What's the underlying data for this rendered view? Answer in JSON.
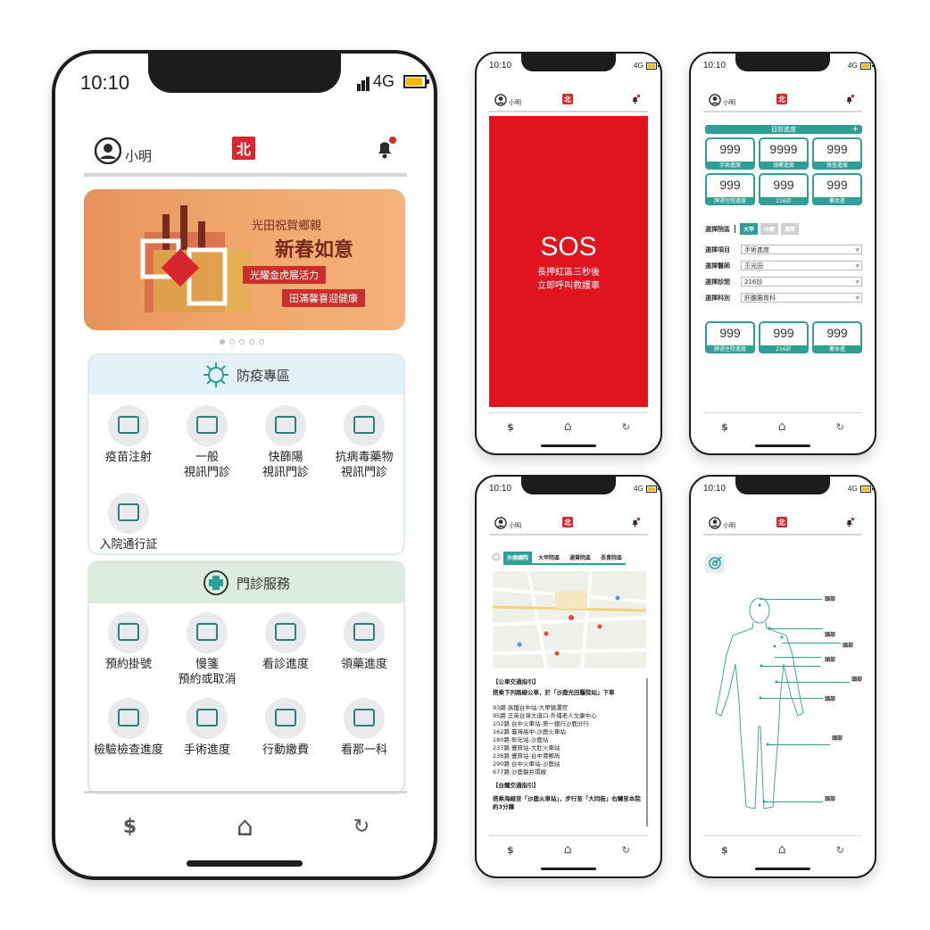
{
  "status": {
    "time": "10:10",
    "network": "4G"
  },
  "header": {
    "user": "小明",
    "logo_text": "北"
  },
  "banner": {
    "line1": "光田祝賀鄉親",
    "line2": "新春如意",
    "line3": "光耀金虎展活力",
    "line4": "田滿馨喜迎健康"
  },
  "sections": [
    {
      "title": "防疫專區",
      "items": [
        {
          "label": "疫苗注射"
        },
        {
          "label": "一般\n視訊門診"
        },
        {
          "label": "快篩陽\n視訊門診"
        },
        {
          "label": "抗病毒藥物\n視訊門診"
        },
        {
          "label": "入院通行証"
        }
      ]
    },
    {
      "title": "門診服務",
      "items": [
        {
          "label": "預約掛號"
        },
        {
          "label": "慢箋\n預約或取消"
        },
        {
          "label": "看診進度"
        },
        {
          "label": "領藥進度"
        },
        {
          "label": "檢驗檢查進度"
        },
        {
          "label": "手術進度"
        },
        {
          "label": "行動繳費"
        },
        {
          "label": "看那一科"
        }
      ]
    }
  ],
  "nav": {
    "pay": "$",
    "home": "⌂",
    "refresh": "↻"
  },
  "sos": {
    "title": "SOS",
    "line1": "長押紅區三秒後",
    "line2": "立即呼叫救護車"
  },
  "progress": {
    "header": "目前進度",
    "plus": "+",
    "top_boxes": [
      {
        "value": "999",
        "label": "手術進度"
      },
      {
        "value": "9999",
        "label": "領藥進度"
      },
      {
        "value": "999",
        "label": "檢查進度"
      },
      {
        "value": "999",
        "label": "牌週住院進度"
      },
      {
        "value": "999",
        "label": "216診"
      },
      {
        "value": "999",
        "label": "藥本進"
      }
    ],
    "hospital_label": "選擇院區",
    "hospital_tabs": [
      "大甲",
      "沙鹿",
      "通霄"
    ],
    "fields": [
      {
        "label": "選擇項目",
        "value": "手術進度"
      },
      {
        "label": "選擇醫師",
        "value": "王光田"
      },
      {
        "label": "選擇診間",
        "value": "216診"
      },
      {
        "label": "選擇科別",
        "value": "肝膽腸胃科"
      }
    ],
    "bottom_boxes": [
      {
        "value": "999",
        "label": "牌週住院進度"
      },
      {
        "value": "999",
        "label": "216診"
      },
      {
        "value": "999",
        "label": "藥本進"
      }
    ]
  },
  "transport": {
    "tabs": [
      "沙鹿總院",
      "大甲院區",
      "通霄院區",
      "長青院區"
    ],
    "bus_title": "【公車交通指引】",
    "bus_intro": "搭乘下列路線公車，於「沙鹿光田醫院站」下車",
    "routes": [
      "93路 高鐵台中站-大甲鎮瀾宮",
      "95路 正英台灣大道口-外埔老人文康中心",
      "102路 台中火車站-第一銀行沙鹿分行",
      "162路 臺灣高中-沙鹿火車站",
      "180路 彰化站-沙鹿站",
      "237路 豐原站-大肚火車站",
      "238路 豐原站-台中港郵局",
      "290路 台中火車站-沙鹿站",
      "677路 沙鹿龍井環線"
    ],
    "train_title": "【台鐵交通指引】",
    "train_text": "搭乘海線至「沙鹿火車站」，步行至「大同街」右轉至本院約3分鐘"
  },
  "body": {
    "labels": [
      "頭部",
      "頭部",
      "頭部",
      "頭部",
      "頭部",
      "頭部",
      "頭部",
      "頭部",
      "頭部"
    ]
  }
}
